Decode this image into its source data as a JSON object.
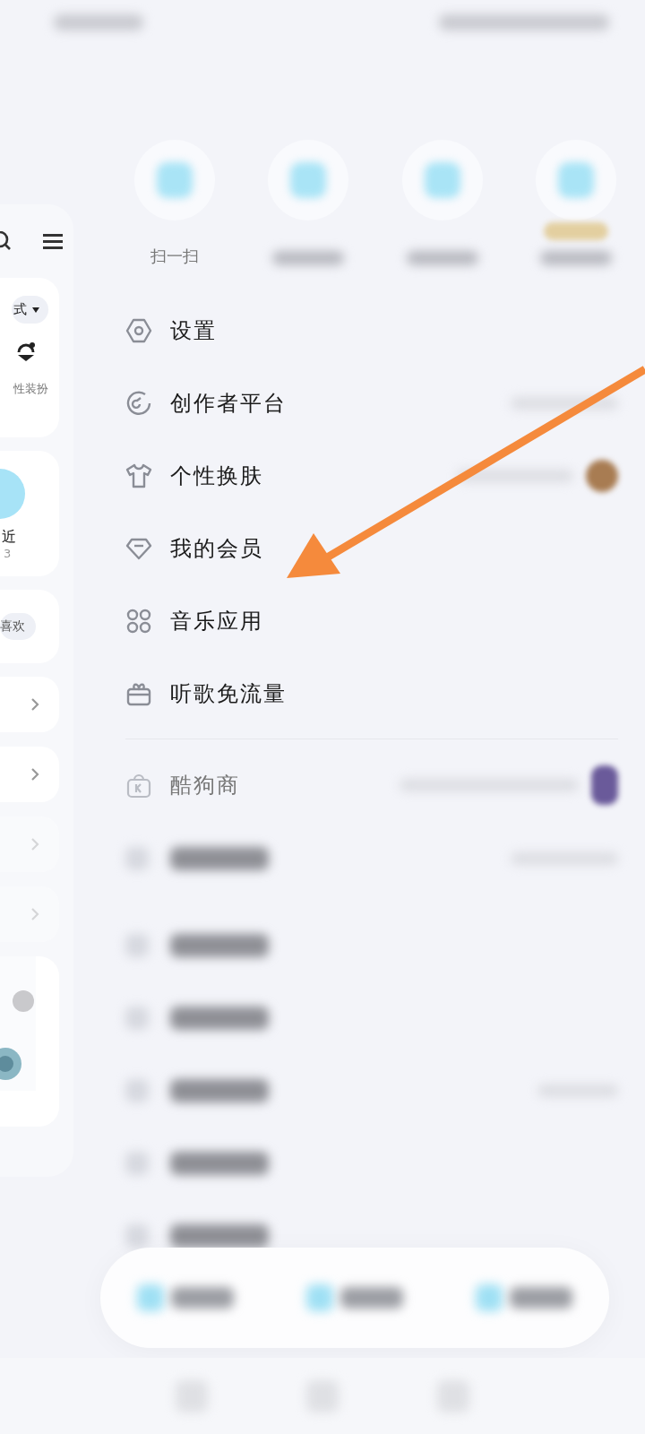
{
  "side_panel": {
    "mode_pill": "式",
    "skin_label": "性装扮",
    "recent_label": "近",
    "recent_count": "3",
    "like_pill": "喜欢",
    "link_rows": [
      {
        "blurred": false
      },
      {
        "blurred": false
      },
      {
        "blurred": true
      },
      {
        "blurred": true
      }
    ]
  },
  "quick_actions": [
    {
      "kind": "labeled",
      "label": "扫一扫"
    },
    {
      "kind": "blurred"
    },
    {
      "kind": "blurred"
    },
    {
      "kind": "badged"
    }
  ],
  "menu": [
    {
      "kind": "plain",
      "label": "设置"
    },
    {
      "kind": "detail",
      "label": "创作者平台"
    },
    {
      "kind": "thumb",
      "label": "个性换肤",
      "color": "#a87c52"
    },
    {
      "kind": "plain",
      "label": "我的会员"
    },
    {
      "kind": "plain",
      "label": "音乐应用"
    },
    {
      "kind": "plain",
      "label": "听歌免流量"
    }
  ],
  "store": {
    "kind": "thumb",
    "label": "酷狗商",
    "color": "#6a5a9a"
  },
  "blurred_rows": [
    {
      "kind": "detail"
    },
    {
      "kind": "plain"
    },
    {
      "kind": "plain"
    },
    {
      "kind": "detail"
    },
    {
      "kind": "plain"
    },
    {
      "kind": "plain"
    }
  ]
}
